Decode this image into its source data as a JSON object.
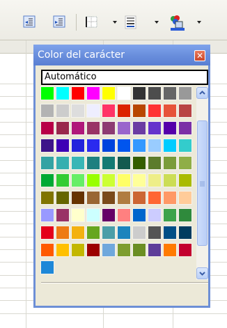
{
  "palette": {
    "title": "Color del carácter",
    "auto_label": "Automático",
    "colors": [
      [
        "#00ff00",
        "#00ffff",
        "#ff0000",
        "#ff00ff",
        "#ffff00",
        "#ffffff",
        "#333333",
        "#4d4d4d",
        "#666666",
        "#999999"
      ],
      [
        "#b3b3b3",
        "#cccccc",
        "#dddddd",
        "#eeeeff",
        "#ff3366",
        "#dc2300",
        "#b84700",
        "#ff3333",
        "#e6543a",
        "#b84444"
      ],
      [
        "#b80047",
        "#99284c",
        "#b0177a",
        "#993366",
        "#8d3b72",
        "#9966cc",
        "#6b3ca3",
        "#6633cc",
        "#5500aa",
        "#7b2fa6"
      ],
      [
        "#3e1489",
        "#3d00b5",
        "#2323dc",
        "#2a2aef",
        "#0044dd",
        "#0055ee",
        "#3399ff",
        "#99ccff",
        "#00ccff",
        "#33cccc"
      ],
      [
        "#33a3a3",
        "#36afb0",
        "#38b6b6",
        "#1e8080",
        "#147a73",
        "#135a4f",
        "#355e00",
        "#5c7c2b",
        "#7a9c3a",
        "#8fae47"
      ],
      [
        "#00a933",
        "#33cc33",
        "#66ee66",
        "#99ff00",
        "#ccff33",
        "#ffff66",
        "#ffff99",
        "#eeee88",
        "#ccdd55",
        "#aabb00"
      ],
      [
        "#807400",
        "#666600",
        "#663300",
        "#996633",
        "#7a4a1a",
        "#b07c40",
        "#cc6633",
        "#ff6633",
        "#ff9966",
        "#ffcc99"
      ],
      [
        "#9999ff",
        "#993366",
        "#ffffcc",
        "#ccffff",
        "#660066",
        "#ff8080",
        "#0066cc",
        "#ccccff",
        "#3da34a",
        "#2f8a3c"
      ],
      [
        "#e4001a",
        "#ee7a14",
        "#f3b10f",
        "#66a61e",
        "#4a9ea8",
        "#1c84bd",
        "#cccccc",
        "#555555",
        "#004f86",
        "#003c5f"
      ],
      [
        "#ff5a00",
        "#ffc000",
        "#c3b700",
        "#9c0000",
        "#6fa8dc",
        "#7d9d2f",
        "#6b8e23",
        "#5e3d99",
        "#ff7b00",
        "#c3002f"
      ],
      [
        "#1e88d8"
      ]
    ]
  }
}
